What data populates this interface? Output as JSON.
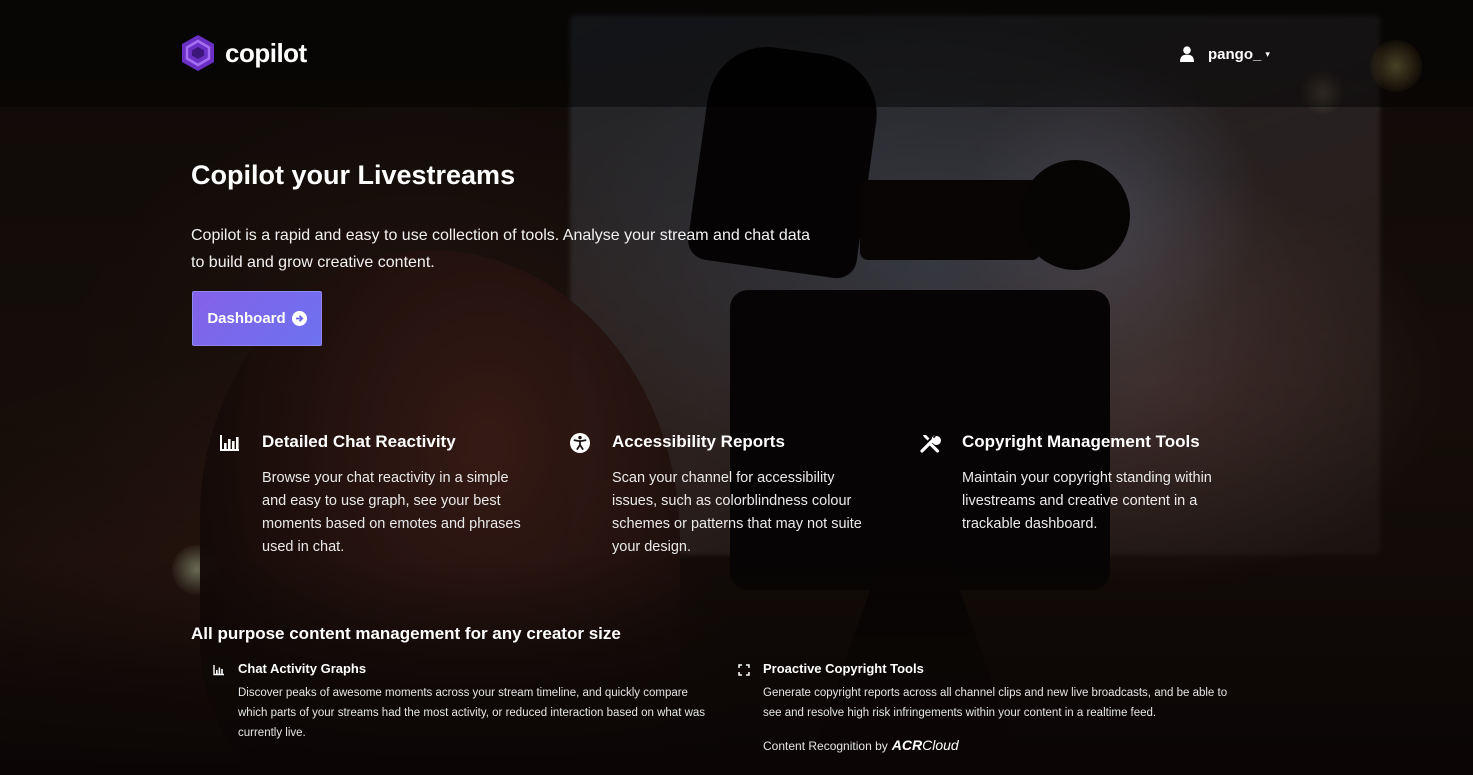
{
  "header": {
    "brand_name": "copilot",
    "username": "pango_",
    "caret": "▾"
  },
  "hero": {
    "title": "Copilot your Livestreams",
    "description": "Copilot is a rapid and easy to use collection of tools. Analyse your stream and chat data to build and grow creative content.",
    "dashboard_label": "Dashboard"
  },
  "features": [
    {
      "icon": "bar-chart-icon",
      "title": "Detailed Chat Reactivity",
      "description": "Browse your chat reactivity in a simple and easy to use graph, see your best moments based on emotes and phrases used in chat."
    },
    {
      "icon": "accessibility-icon",
      "title": "Accessibility Reports",
      "description": "Scan your channel for accessibility issues, such as colorblindness colour schemes or patterns that may not suite your design."
    },
    {
      "icon": "tools-icon",
      "title": "Copyright Management Tools",
      "description": "Maintain your copyright standing within livestreams and creative content in a trackable dashboard."
    }
  ],
  "section": {
    "heading": "All purpose content management for any creator size",
    "items": [
      {
        "icon": "bar-chart-icon",
        "title": "Chat Activity Graphs",
        "description": "Discover peaks of awesome moments across your stream timeline, and quickly compare which parts of your streams had the most activity, or reduced interaction based on what was currently live."
      },
      {
        "icon": "expand-icon",
        "title": "Proactive Copyright Tools",
        "description": "Generate copyright reports across all channel clips and new live broadcasts, and be able to see and resolve high risk infringements within your content in a realtime feed."
      }
    ],
    "acr_prefix": "Content Recognition by",
    "acr_brand_bold": "ACR",
    "acr_brand_rest": "Cloud"
  },
  "colors": {
    "accent_start": "#8361e8",
    "accent_end": "#6d72f0",
    "logo_purple": "#7b3fd4"
  }
}
